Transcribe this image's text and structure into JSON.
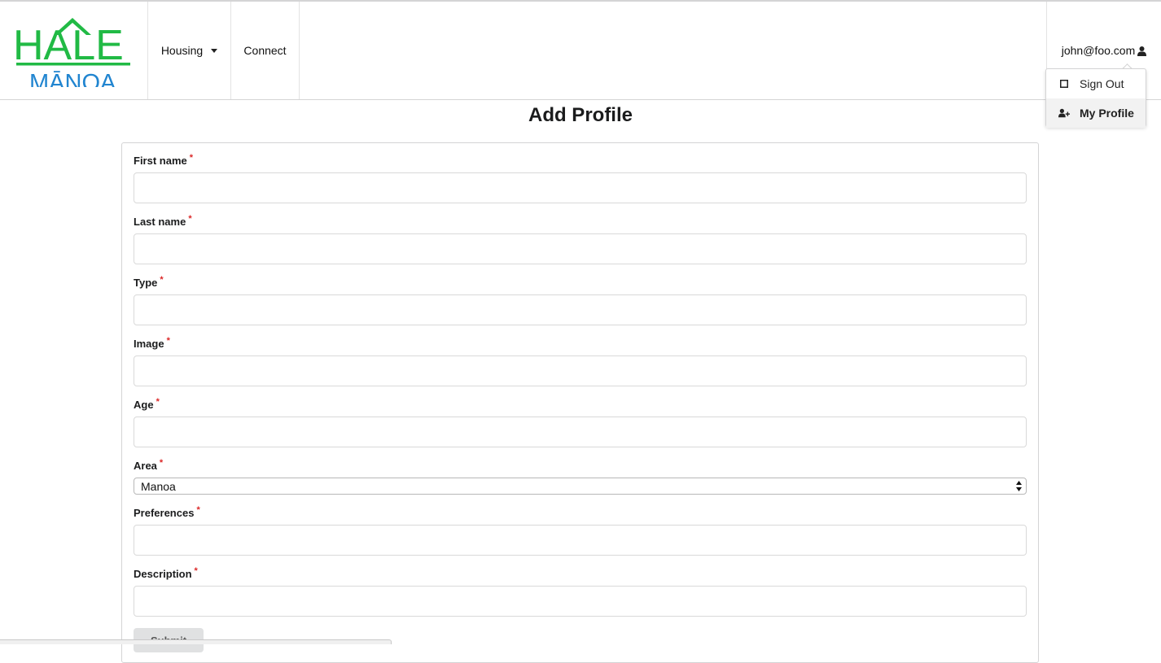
{
  "navbar": {
    "logo_top": "HALE",
    "logo_bottom": "MĀNOA",
    "housing_label": "Housing",
    "connect_label": "Connect",
    "user_email": "john@foo.com"
  },
  "user_menu": {
    "sign_out_label": "Sign Out",
    "my_profile_label": "My Profile"
  },
  "page": {
    "title": "Add Profile"
  },
  "form": {
    "required_mark": "*",
    "fields": [
      {
        "label": "First name",
        "value": ""
      },
      {
        "label": "Last name",
        "value": ""
      },
      {
        "label": "Type",
        "value": ""
      },
      {
        "label": "Image",
        "value": ""
      },
      {
        "label": "Age",
        "value": ""
      },
      {
        "label": "Area",
        "value": "Manoa"
      },
      {
        "label": "Preferences",
        "value": ""
      },
      {
        "label": "Description",
        "value": ""
      }
    ],
    "submit_label": "Submit"
  },
  "colors": {
    "logo_green": "#21ba45",
    "logo_blue": "#2185d0",
    "required_red": "#db2828"
  },
  "icons": [
    "user-icon",
    "sign-out-icon",
    "add-user-icon",
    "chevron-down-icon",
    "select-arrows-icon",
    "house-roof-icon"
  ]
}
